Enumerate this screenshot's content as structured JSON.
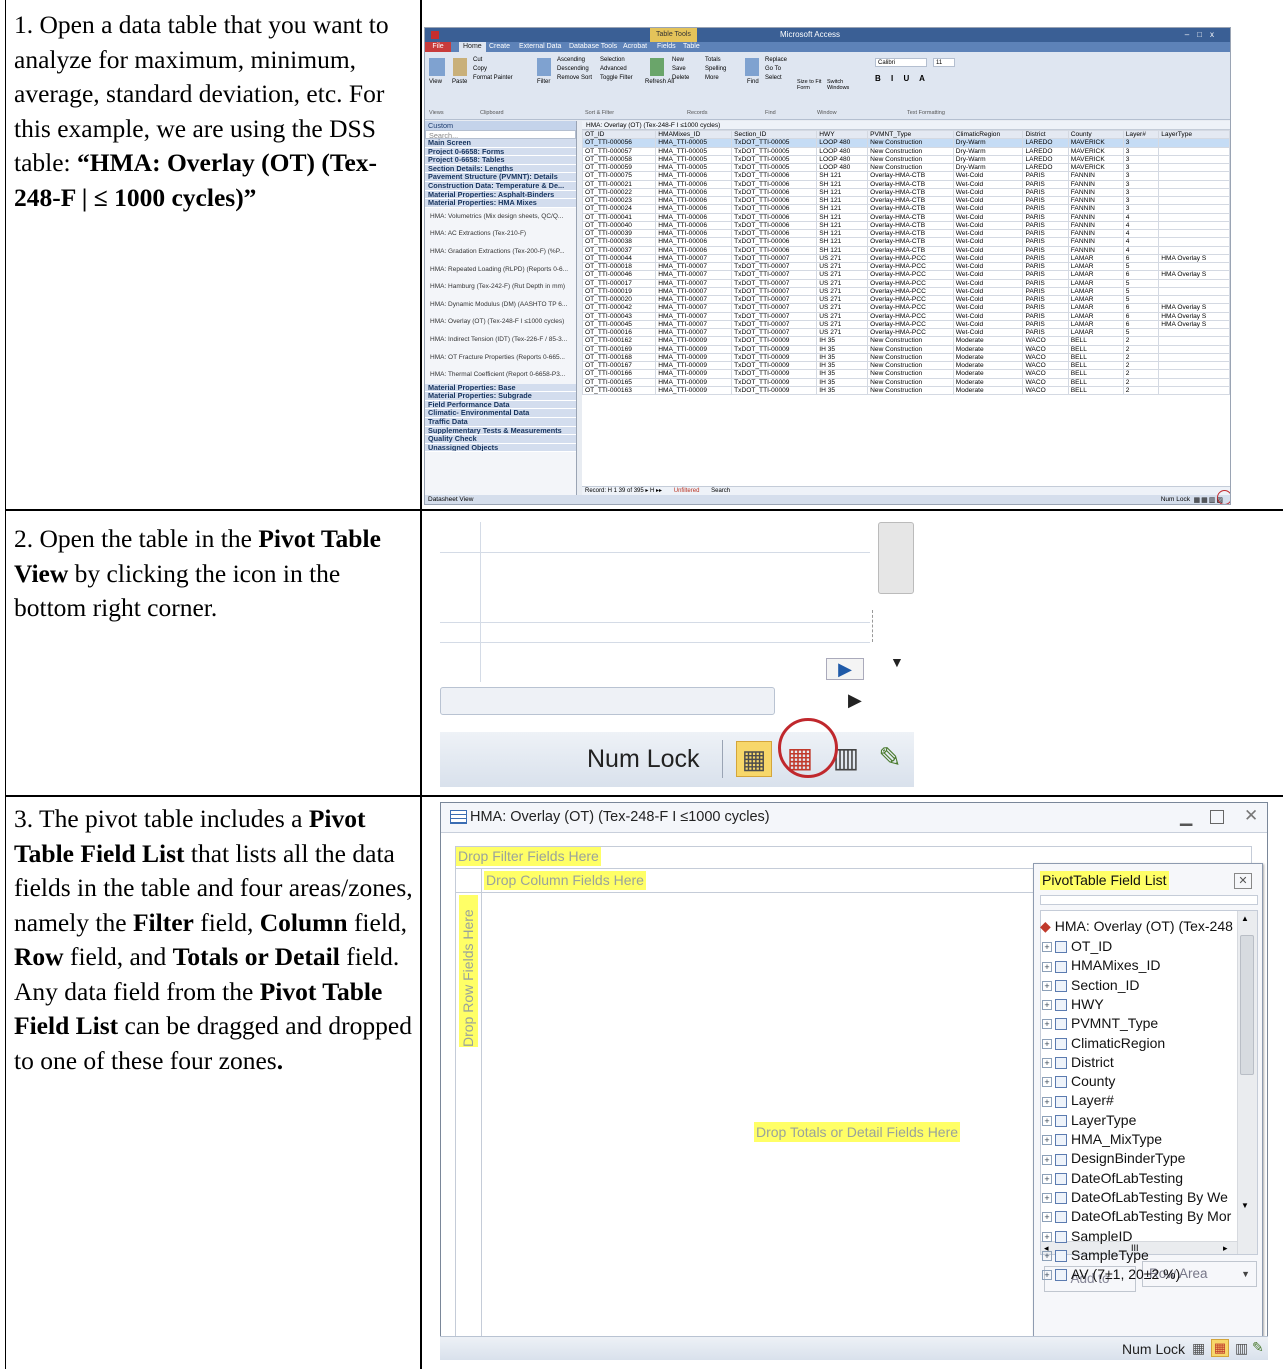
{
  "steps": [
    {
      "num_text": "1. Open a data table that you want to analyze for maximum, minimum, average, standard deviation, etc. For this example, we are using the DSS table:",
      "bold_text": "“HMA: Overlay (OT) (Tex-248-F | ≤ 1000 cycles)”"
    },
    {
      "pre": "2. Open the table in the ",
      "bold": "Pivot Table View",
      "post": " by clicking the icon in the bottom right corner."
    },
    {
      "t1": "3. The pivot table includes a ",
      "b1": "Pivot Table Field List",
      "t2": " that lists all the data fields in the table and four areas/zones, namely the ",
      "b2": "Filter",
      "t3": " field, ",
      "b3": "Column",
      "t4": " field, ",
      "b4": "Row",
      "t5": " field, and ",
      "b5": "Totals or Detail",
      "t6": " field. Any data field from the ",
      "b6": "Pivot Table Field List",
      "t7": " can be dragged and dropped to one of these four zones",
      "b7": "."
    }
  ],
  "access": {
    "app_title": "Microsoft Access",
    "tool_tab": "Table Tools",
    "tabs": [
      "File",
      "Home",
      "Create",
      "External Data",
      "Database Tools",
      "Acrobat",
      "Fields",
      "Table"
    ],
    "ribbon_groups": [
      "Views",
      "Clipboard",
      "Sort & Filter",
      "Records",
      "Find",
      "Window",
      "Text Formatting"
    ],
    "ribbon_labels": [
      "View",
      "Paste",
      "Cut",
      "Copy",
      "Format Painter",
      "Filter",
      "Ascending",
      "Descending",
      "Remove Sort",
      "Selection",
      "Advanced",
      "Toggle Filter",
      "Refresh All",
      "New",
      "Save",
      "Delete",
      "Totals",
      "Spelling",
      "More",
      "Find",
      "Replace",
      "Go To",
      "Select",
      "Size to Fit Form",
      "Switch Windows",
      "Calibri",
      "11"
    ],
    "nav_header": "Custom",
    "nav_search": "Search...",
    "nav_groups_top": [
      "Main Screen",
      "Project 0-6658: Forms",
      "Project 0-6658: Tables",
      "Section Details: Lengths",
      "Pavement Structure (PVMNT): Details",
      "Construction Data: Temperature & De...",
      "Material Properties: Asphalt-Binders",
      "Material Properties: HMA Mixes"
    ],
    "nav_objects": [
      "HMA: Volumetrics (Mix design sheets, QC/Q...",
      "HMA: AC Extractions (Tex-210-F)",
      "HMA: Gradation Extractions (Tex-200-F) (%P...",
      "HMA: Repeated Loading (RLPD) (Reports 0-6...",
      "HMA: Hamburg (Tex-242-F) (Rut Depth in mm)",
      "HMA: Dynamic Modulus (DM) (AASHTO TP 6...",
      "HMA: Overlay (OT) (Tex-248-F I ≤1000 cycles)",
      "HMA: Indirect Tension (IDT) (Tex-226-F / 85-3...",
      "HMA: OT Fracture Properties (Reports 0-665...",
      "HMA: Thermal Coefficient (Report 0-6658-P3..."
    ],
    "nav_groups_bottom": [
      "Material Properties: Base",
      "Material Properties: Subgrade",
      "Field Performance Data",
      "Climatic- Environmental Data",
      "Traffic Data",
      "Supplementary Tests & Measurements",
      "Quality Check",
      "Unassigned Objects"
    ],
    "grid_title": "HMA: Overlay (OT) (Tex-248-F I ≤1000 cycles)",
    "columns": [
      "OT_ID",
      "HMAMixes_ID",
      "Section_ID",
      "HWY",
      "PVMNT_Type",
      "ClimaticRegion",
      "District",
      "County",
      "Layer#",
      "LayerType"
    ],
    "rows": [
      [
        "OT_TTI-000056",
        "HMA_TTI-00005",
        "TxDOT_TTI-00005",
        "LOOP 480",
        "New Construction",
        "Dry-Warm",
        "LAREDO",
        "MAVERICK",
        "3",
        ""
      ],
      [
        "OT_TTI-000057",
        "HMA_TTI-00005",
        "TxDOT_TTI-00005",
        "LOOP 480",
        "New Construction",
        "Dry-Warm",
        "LAREDO",
        "MAVERICK",
        "3",
        ""
      ],
      [
        "OT_TTI-000058",
        "HMA_TTI-00005",
        "TxDOT_TTI-00005",
        "LOOP 480",
        "New Construction",
        "Dry-Warm",
        "LAREDO",
        "MAVERICK",
        "3",
        ""
      ],
      [
        "OT_TTI-000059",
        "HMA_TTI-00005",
        "TxDOT_TTI-00005",
        "LOOP 480",
        "New Construction",
        "Dry-Warm",
        "LAREDO",
        "MAVERICK",
        "3",
        ""
      ],
      [
        "OT_TTI-000075",
        "HMA_TTI-00006",
        "TxDOT_TTI-00006",
        "SH 121",
        "Overlay-HMA-CTB",
        "Wet-Cold",
        "PARIS",
        "FANNIN",
        "3",
        ""
      ],
      [
        "OT_TTI-000021",
        "HMA_TTI-00006",
        "TxDOT_TTI-00006",
        "SH 121",
        "Overlay-HMA-CTB",
        "Wet-Cold",
        "PARIS",
        "FANNIN",
        "3",
        ""
      ],
      [
        "OT_TTI-000022",
        "HMA_TTI-00006",
        "TxDOT_TTI-00006",
        "SH 121",
        "Overlay-HMA-CTB",
        "Wet-Cold",
        "PARIS",
        "FANNIN",
        "3",
        ""
      ],
      [
        "OT_TTI-000023",
        "HMA_TTI-00006",
        "TxDOT_TTI-00006",
        "SH 121",
        "Overlay-HMA-CTB",
        "Wet-Cold",
        "PARIS",
        "FANNIN",
        "3",
        ""
      ],
      [
        "OT_TTI-000024",
        "HMA_TTI-00006",
        "TxDOT_TTI-00006",
        "SH 121",
        "Overlay-HMA-CTB",
        "Wet-Cold",
        "PARIS",
        "FANNIN",
        "3",
        ""
      ],
      [
        "OT_TTI-000041",
        "HMA_TTI-00006",
        "TxDOT_TTI-00006",
        "SH 121",
        "Overlay-HMA-CTB",
        "Wet-Cold",
        "PARIS",
        "FANNIN",
        "4",
        ""
      ],
      [
        "OT_TTI-000040",
        "HMA_TTI-00006",
        "TxDOT_TTI-00006",
        "SH 121",
        "Overlay-HMA-CTB",
        "Wet-Cold",
        "PARIS",
        "FANNIN",
        "4",
        ""
      ],
      [
        "OT_TTI-000039",
        "HMA_TTI-00006",
        "TxDOT_TTI-00006",
        "SH 121",
        "Overlay-HMA-CTB",
        "Wet-Cold",
        "PARIS",
        "FANNIN",
        "4",
        ""
      ],
      [
        "OT_TTI-000038",
        "HMA_TTI-00006",
        "TxDOT_TTI-00006",
        "SH 121",
        "Overlay-HMA-CTB",
        "Wet-Cold",
        "PARIS",
        "FANNIN",
        "4",
        ""
      ],
      [
        "OT_TTI-000037",
        "HMA_TTI-00006",
        "TxDOT_TTI-00006",
        "SH 121",
        "Overlay-HMA-CTB",
        "Wet-Cold",
        "PARIS",
        "FANNIN",
        "4",
        ""
      ],
      [
        "OT_TTI-000044",
        "HMA_TTI-00007",
        "TxDOT_TTI-00007",
        "US 271",
        "Overlay-HMA-PCC",
        "Wet-Cold",
        "PARIS",
        "LAMAR",
        "6",
        "HMA Overlay S"
      ],
      [
        "OT_TTI-000018",
        "HMA_TTI-00007",
        "TxDOT_TTI-00007",
        "US 271",
        "Overlay-HMA-PCC",
        "Wet-Cold",
        "PARIS",
        "LAMAR",
        "5",
        ""
      ],
      [
        "OT_TTI-000046",
        "HMA_TTI-00007",
        "TxDOT_TTI-00007",
        "US 271",
        "Overlay-HMA-PCC",
        "Wet-Cold",
        "PARIS",
        "LAMAR",
        "6",
        "HMA Overlay S"
      ],
      [
        "OT_TTI-000017",
        "HMA_TTI-00007",
        "TxDOT_TTI-00007",
        "US 271",
        "Overlay-HMA-PCC",
        "Wet-Cold",
        "PARIS",
        "LAMAR",
        "5",
        ""
      ],
      [
        "OT_TTI-000019",
        "HMA_TTI-00007",
        "TxDOT_TTI-00007",
        "US 271",
        "Overlay-HMA-PCC",
        "Wet-Cold",
        "PARIS",
        "LAMAR",
        "5",
        ""
      ],
      [
        "OT_TTI-000020",
        "HMA_TTI-00007",
        "TxDOT_TTI-00007",
        "US 271",
        "Overlay-HMA-PCC",
        "Wet-Cold",
        "PARIS",
        "LAMAR",
        "5",
        ""
      ],
      [
        "OT_TTI-000042",
        "HMA_TTI-00007",
        "TxDOT_TTI-00007",
        "US 271",
        "Overlay-HMA-PCC",
        "Wet-Cold",
        "PARIS",
        "LAMAR",
        "6",
        "HMA Overlay S"
      ],
      [
        "OT_TTI-000043",
        "HMA_TTI-00007",
        "TxDOT_TTI-00007",
        "US 271",
        "Overlay-HMA-PCC",
        "Wet-Cold",
        "PARIS",
        "LAMAR",
        "6",
        "HMA Overlay S"
      ],
      [
        "OT_TTI-000045",
        "HMA_TTI-00007",
        "TxDOT_TTI-00007",
        "US 271",
        "Overlay-HMA-PCC",
        "Wet-Cold",
        "PARIS",
        "LAMAR",
        "6",
        "HMA Overlay S"
      ],
      [
        "OT_TTI-000016",
        "HMA_TTI-00007",
        "TxDOT_TTI-00007",
        "US 271",
        "Overlay-HMA-PCC",
        "Wet-Cold",
        "PARIS",
        "LAMAR",
        "5",
        ""
      ],
      [
        "OT_TTI-000162",
        "HMA_TTI-00009",
        "TxDOT_TTI-00009",
        "IH 35",
        "New Construction",
        "Moderate",
        "WACO",
        "BELL",
        "2",
        ""
      ],
      [
        "OT_TTI-000169",
        "HMA_TTI-00009",
        "TxDOT_TTI-00009",
        "IH 35",
        "New Construction",
        "Moderate",
        "WACO",
        "BELL",
        "2",
        ""
      ],
      [
        "OT_TTI-000168",
        "HMA_TTI-00009",
        "TxDOT_TTI-00009",
        "IH 35",
        "New Construction",
        "Moderate",
        "WACO",
        "BELL",
        "2",
        ""
      ],
      [
        "OT_TTI-000167",
        "HMA_TTI-00009",
        "TxDOT_TTI-00009",
        "IH 35",
        "New Construction",
        "Moderate",
        "WACO",
        "BELL",
        "2",
        ""
      ],
      [
        "OT_TTI-000166",
        "HMA_TTI-00009",
        "TxDOT_TTI-00009",
        "IH 35",
        "New Construction",
        "Moderate",
        "WACO",
        "BELL",
        "2",
        ""
      ],
      [
        "OT_TTI-000165",
        "HMA_TTI-00009",
        "TxDOT_TTI-00009",
        "IH 35",
        "New Construction",
        "Moderate",
        "WACO",
        "BELL",
        "2",
        ""
      ],
      [
        "OT_TTI-000163",
        "HMA_TTI-00009",
        "TxDOT_TTI-00009",
        "IH 35",
        "New Construction",
        "Moderate",
        "WACO",
        "BELL",
        "2",
        ""
      ]
    ],
    "record_nav": "Record: H  1 39 of 395  ▸ H ▸▸",
    "unfiltered": "Unfiltered",
    "search": "Search",
    "status_left": "Datasheet View",
    "status_right": "Num Lock"
  },
  "zoom": {
    "num_lock": "Num Lock"
  },
  "pivot": {
    "title": "HMA: Overlay (OT) (Tex-248-F I ≤1000 cycles)",
    "drop_filter": "Drop Filter Fields Here",
    "drop_column": "Drop Column Fields Here",
    "drop_row": "Drop Row Fields Here",
    "drop_totals": "Drop Totals or Detail Fields Here",
    "field_list_title": "PivotTable Field List",
    "field_root": "HMA: Overlay (OT) (Tex-248",
    "fields": [
      "OT_ID",
      "HMAMixes_ID",
      "Section_ID",
      "HWY",
      "PVMNT_Type",
      "ClimaticRegion",
      "District",
      "County",
      "Layer#",
      "LayerType",
      "HMA_MixType",
      "DesignBinderType",
      "DateOfLabTesting",
      "DateOfLabTesting By We",
      "DateOfLabTesting By Mor",
      "SampleID",
      "SampleType",
      "AV (7±1, 20±2 %)"
    ],
    "scroll_mark": "III",
    "add_to": "Add to",
    "area_select": "Row Area",
    "status_num_lock": "Num Lock"
  }
}
